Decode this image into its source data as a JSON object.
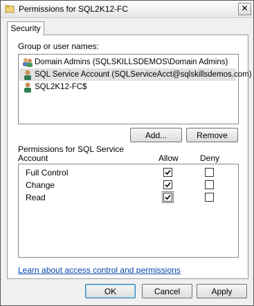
{
  "window": {
    "title": "Permissions for SQL2K12-FC",
    "close_glyph": "✕"
  },
  "tabs": [
    {
      "label": "Security",
      "active": true
    }
  ],
  "principals": {
    "label": "Group or user names:",
    "items": [
      {
        "name": "Domain Admins (SQLSKILLSDEMOS\\Domain Admins)",
        "icon": "group-icon",
        "selected": false
      },
      {
        "name": "SQL Service Account (SQLServiceAcct@sqlskillsdemos.com)",
        "icon": "user-icon",
        "selected": true
      },
      {
        "name": "SQL2K12-FC$",
        "icon": "computer-account-icon",
        "selected": false
      }
    ]
  },
  "buttons": {
    "add": "Add...",
    "remove": "Remove",
    "ok": "OK",
    "cancel": "Cancel",
    "apply": "Apply"
  },
  "permissions": {
    "label_line1": "Permissions for SQL Service",
    "label_line2": "Account",
    "allow_header": "Allow",
    "deny_header": "Deny",
    "rows": [
      {
        "name": "Full Control",
        "allow": true,
        "deny": false
      },
      {
        "name": "Change",
        "allow": true,
        "deny": false
      },
      {
        "name": "Read",
        "allow": true,
        "deny": false
      }
    ]
  },
  "help_link": "Learn about access control and permissions",
  "colors": {
    "link": "#0645ad",
    "selection": "#e1e1e1",
    "default_button_border": "#3c7fb1"
  }
}
